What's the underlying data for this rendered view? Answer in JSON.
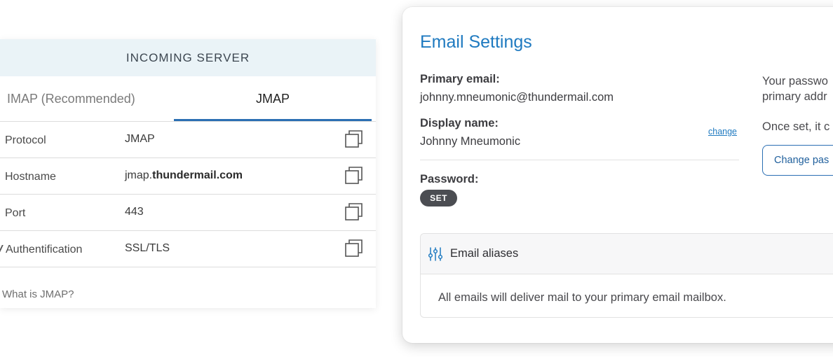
{
  "incoming_server": {
    "header": "INCOMING SERVER",
    "tabs": [
      {
        "label": "IMAP (Recommended)",
        "active": false
      },
      {
        "label": "JMAP",
        "active": true
      }
    ],
    "rows": [
      {
        "label": "Protocol",
        "value": "JMAP"
      },
      {
        "label": "Hostname",
        "value_prefix": "jmap.",
        "value_bold": "thundermail.com"
      },
      {
        "label": "Port",
        "value": "443"
      },
      {
        "label": "Authentification",
        "value": "SSL/TLS"
      }
    ],
    "footer_link": "What is JMAP?",
    "accent_color": "#2b6fb3",
    "icons": {
      "copy": "copy-icon"
    }
  },
  "email_settings": {
    "title": "Email Settings",
    "primary_email_label": "Primary email:",
    "primary_email_value": "johnny.mneumonic@thundermail.com",
    "display_name_label": "Display name:",
    "display_name_value": "Johnny Mneumonic",
    "change_link": "change",
    "password_label": "Password:",
    "password_badge": "SET",
    "side_text_line1": "Your passwo",
    "side_text_line2": "primary addr",
    "side_text_line3": "Once set, it c",
    "change_password_button": "Change pas",
    "aliases": {
      "title": "Email aliases",
      "body": "All emails will deliver mail to your primary email mailbox.",
      "icon": "sliders-icon"
    },
    "title_color": "#1f7ac0"
  }
}
